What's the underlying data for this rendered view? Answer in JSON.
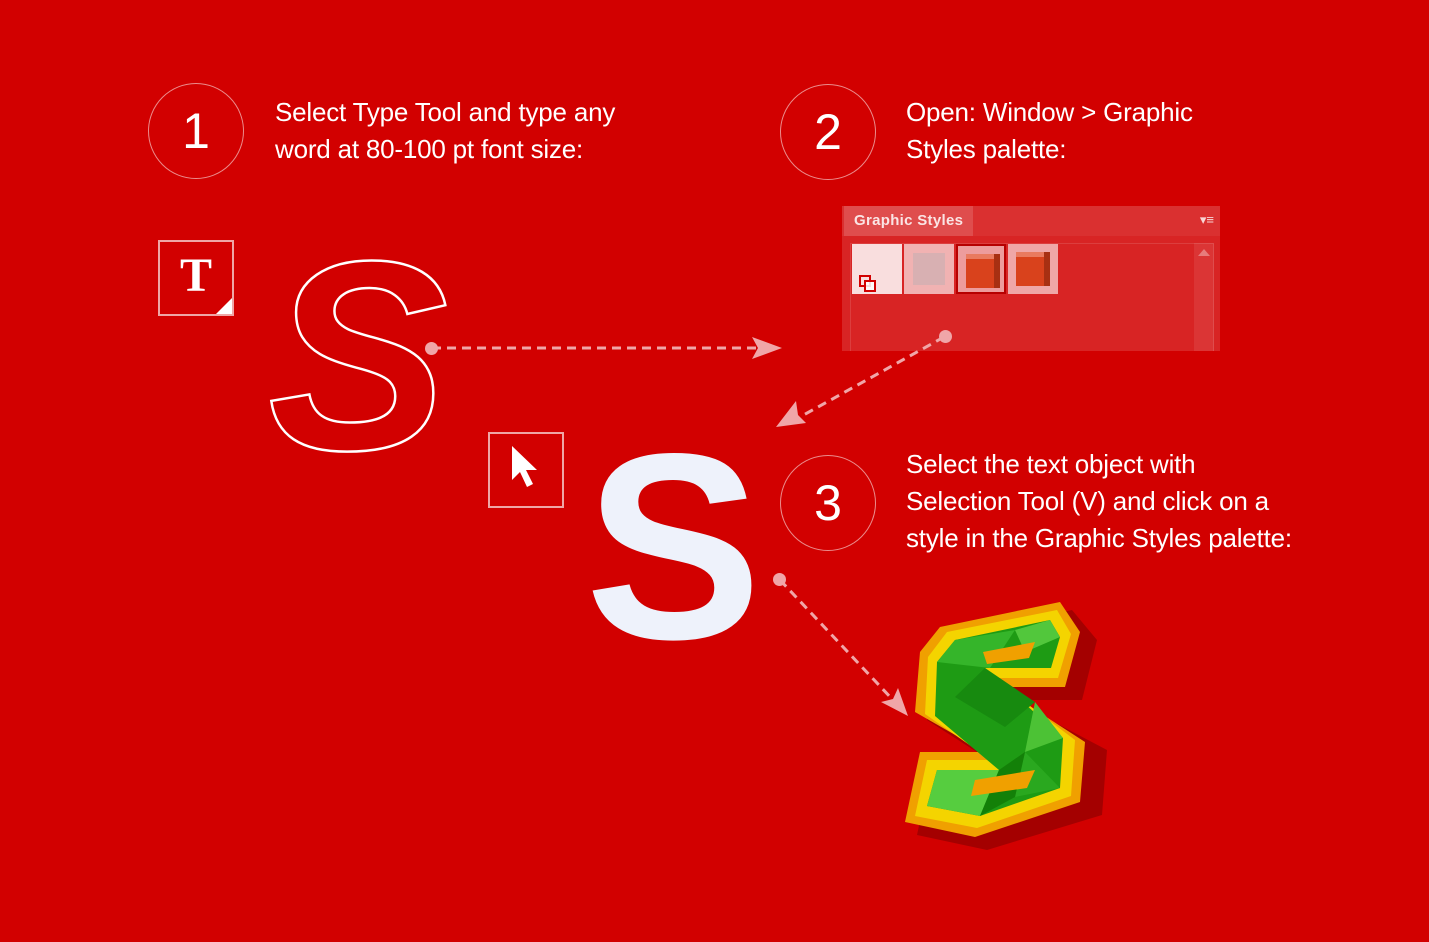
{
  "steps": [
    {
      "number": "1",
      "text_line1": "Select Type Tool and type any",
      "text_line2": "word at 80-100 pt font size:"
    },
    {
      "number": "2",
      "text_line1": "Open: Window > Graphic",
      "text_line2": "Styles palette:"
    },
    {
      "number": "3",
      "text_line1": "Select the text object with",
      "text_line2": "Selection Tool (V) and click on a",
      "text_line3": "style in the Graphic Styles palette:"
    }
  ],
  "type_tool": {
    "glyph": "T",
    "icon": "type-tool-icon"
  },
  "selection_tool": {
    "icon": "selection-arrow-icon"
  },
  "letters": {
    "outline": "S",
    "solid": "S",
    "styled": "S"
  },
  "palette": {
    "title": "Graphic Styles",
    "menu_glyph": "▾≡"
  },
  "colors": {
    "background": "#d20000",
    "arrow": "#f0a6a8",
    "styled_green": "#1e9b14",
    "styled_yellow": "#f4d400",
    "styled_orange": "#f0a000",
    "cube_orange": "#d9421c"
  }
}
